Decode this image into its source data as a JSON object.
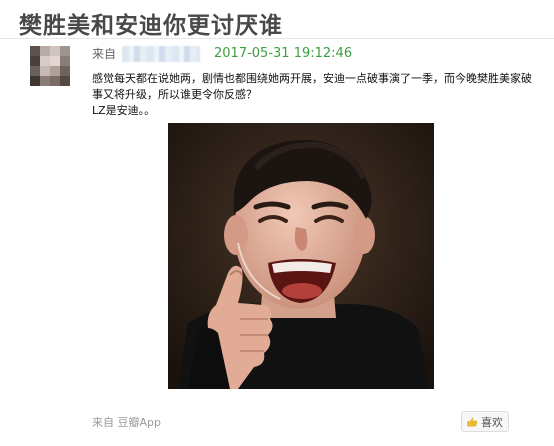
{
  "post": {
    "title": "樊胜美和安迪你更讨厌谁",
    "from_label": "来自",
    "timestamp": "2017-05-31 19:12:46",
    "paragraph_1": "感觉每天都在说她两，剧情也都围绕她两开展，安迪一点破事演了一季，而今晚樊胜美家破事又将升级，所以谁更令你反感？",
    "paragraph_2": "LZ是安迪。。"
  },
  "footer": {
    "source": "来自 豆瓣App",
    "like_label": "喜欢"
  },
  "icons": {
    "like": "thumbs-up-icon"
  },
  "colors": {
    "timestamp": "#3a9e3f",
    "title": "#494949"
  }
}
